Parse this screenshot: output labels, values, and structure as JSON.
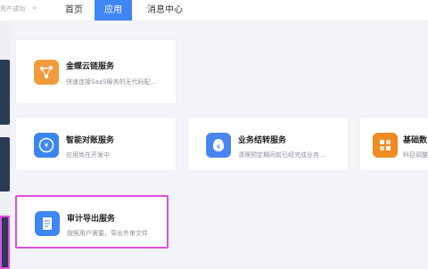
{
  "header": {
    "account_text": "资产成功",
    "nav": {
      "home": "首页",
      "apps": "应用",
      "messages": "消息中心"
    }
  },
  "cards": [
    {
      "title": "金蝶云链服务",
      "desc": "快速连接SaaS服务的无代码配..."
    },
    {
      "title": "智能对账服务",
      "desc": "应用尚在开发中"
    },
    {
      "title": "业务结转服务",
      "desc": "清理预定期间前已经完成业务..."
    },
    {
      "title": "基础数",
      "desc": "科目调整"
    },
    {
      "title": "审计导出服务",
      "desc": "按照用户需要，导出外审文件"
    }
  ],
  "colors": {
    "accent": "#3f86f6",
    "selection": "#e04ce6",
    "cloud_icon": "#f39a3b",
    "recon_icon": "#3c86f1",
    "carry_icon": "#4a86f2",
    "base_icon": "#f08a22",
    "audit_icon": "#3f86f6"
  }
}
